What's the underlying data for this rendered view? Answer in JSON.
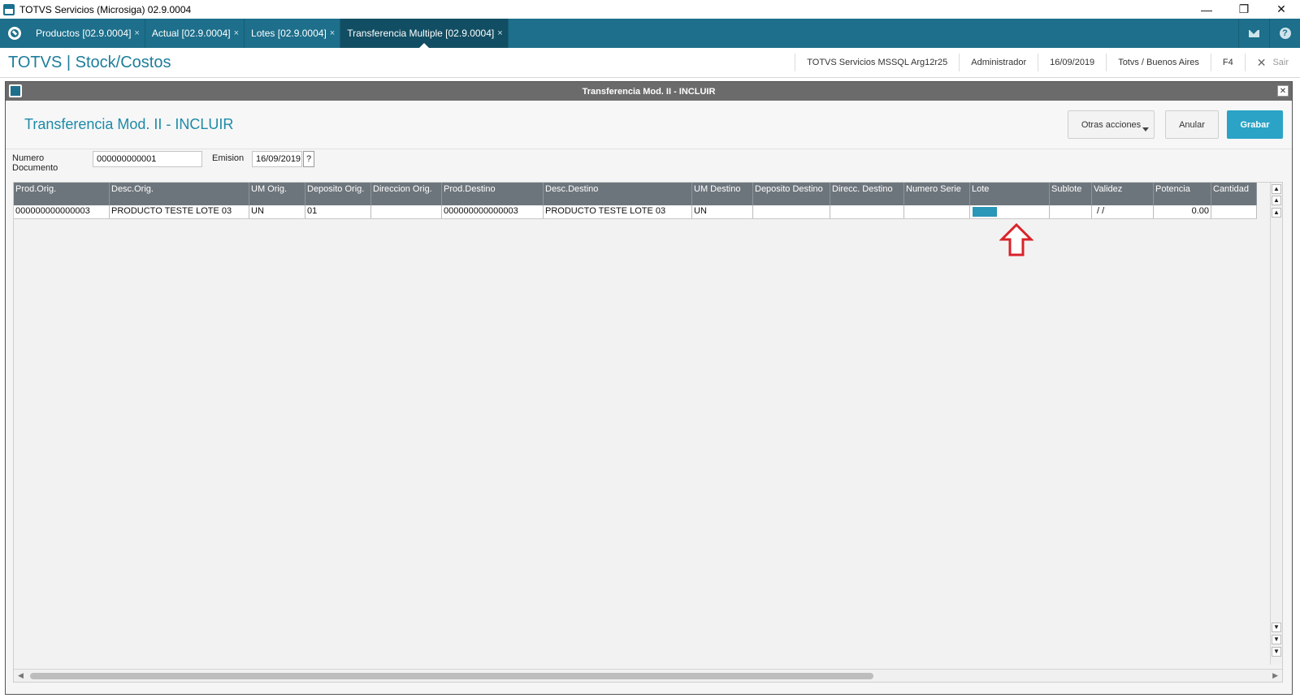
{
  "window": {
    "title": "TOTVS Servicios (Microsiga) 02.9.0004"
  },
  "tabs": [
    {
      "label": "Productos [02.9.0004]",
      "close": "×"
    },
    {
      "label": "Actual [02.9.0004]",
      "close": "×"
    },
    {
      "label": "Lotes [02.9.0004]",
      "close": "×"
    },
    {
      "label": "Transferencia Multiple [02.9.0004]",
      "close": "×"
    }
  ],
  "header": {
    "app_title": "TOTVS | Stock/Costos",
    "environment": "TOTVS Servicios MSSQL Arg12r25",
    "user": "Administrador",
    "date": "16/09/2019",
    "branch": "Totvs / Buenos Aires",
    "shortcut": "F4",
    "exit_label": "Sair"
  },
  "dialog": {
    "window_title": "Transferencia Mod. II - INCLUIR",
    "heading": "Transferencia Mod. II - INCLUIR",
    "buttons": {
      "more": "Otras acciones",
      "cancel": "Anular",
      "save": "Grabar"
    },
    "form": {
      "doc_label": "Numero Documento",
      "doc_value": "000000000001",
      "date_label": "Emision",
      "date_value": "16/09/2019",
      "help": "?"
    },
    "grid": {
      "columns": [
        "Prod.Orig.",
        "Desc.Orig.",
        "UM Orig.",
        "Deposito Orig.",
        "Direccion Orig.",
        "Prod.Destino",
        "Desc.Destino",
        "UM Destino",
        "Deposito Destino",
        "Direcc. Destino",
        "Numero Serie",
        "Lote",
        "Sublote",
        "Validez",
        "Potencia",
        "Cantidad"
      ],
      "rows": [
        [
          "000000000000003",
          "PRODUCTO TESTE LOTE 03",
          "UN",
          "01",
          "",
          "000000000000003",
          "PRODUCTO TESTE LOTE 03",
          "UN",
          "",
          "",
          "",
          "",
          "",
          " /  /",
          "0.00",
          ""
        ]
      ]
    }
  },
  "colors": {
    "accent": "#1d6f8b",
    "primary_button": "#2aa3c6",
    "arrow": "#d9232a"
  },
  "icons": [
    "app-logo-icon",
    "mail-icon",
    "help-icon",
    "close-icon",
    "chevron-down-icon",
    "arrow-up-icon"
  ]
}
